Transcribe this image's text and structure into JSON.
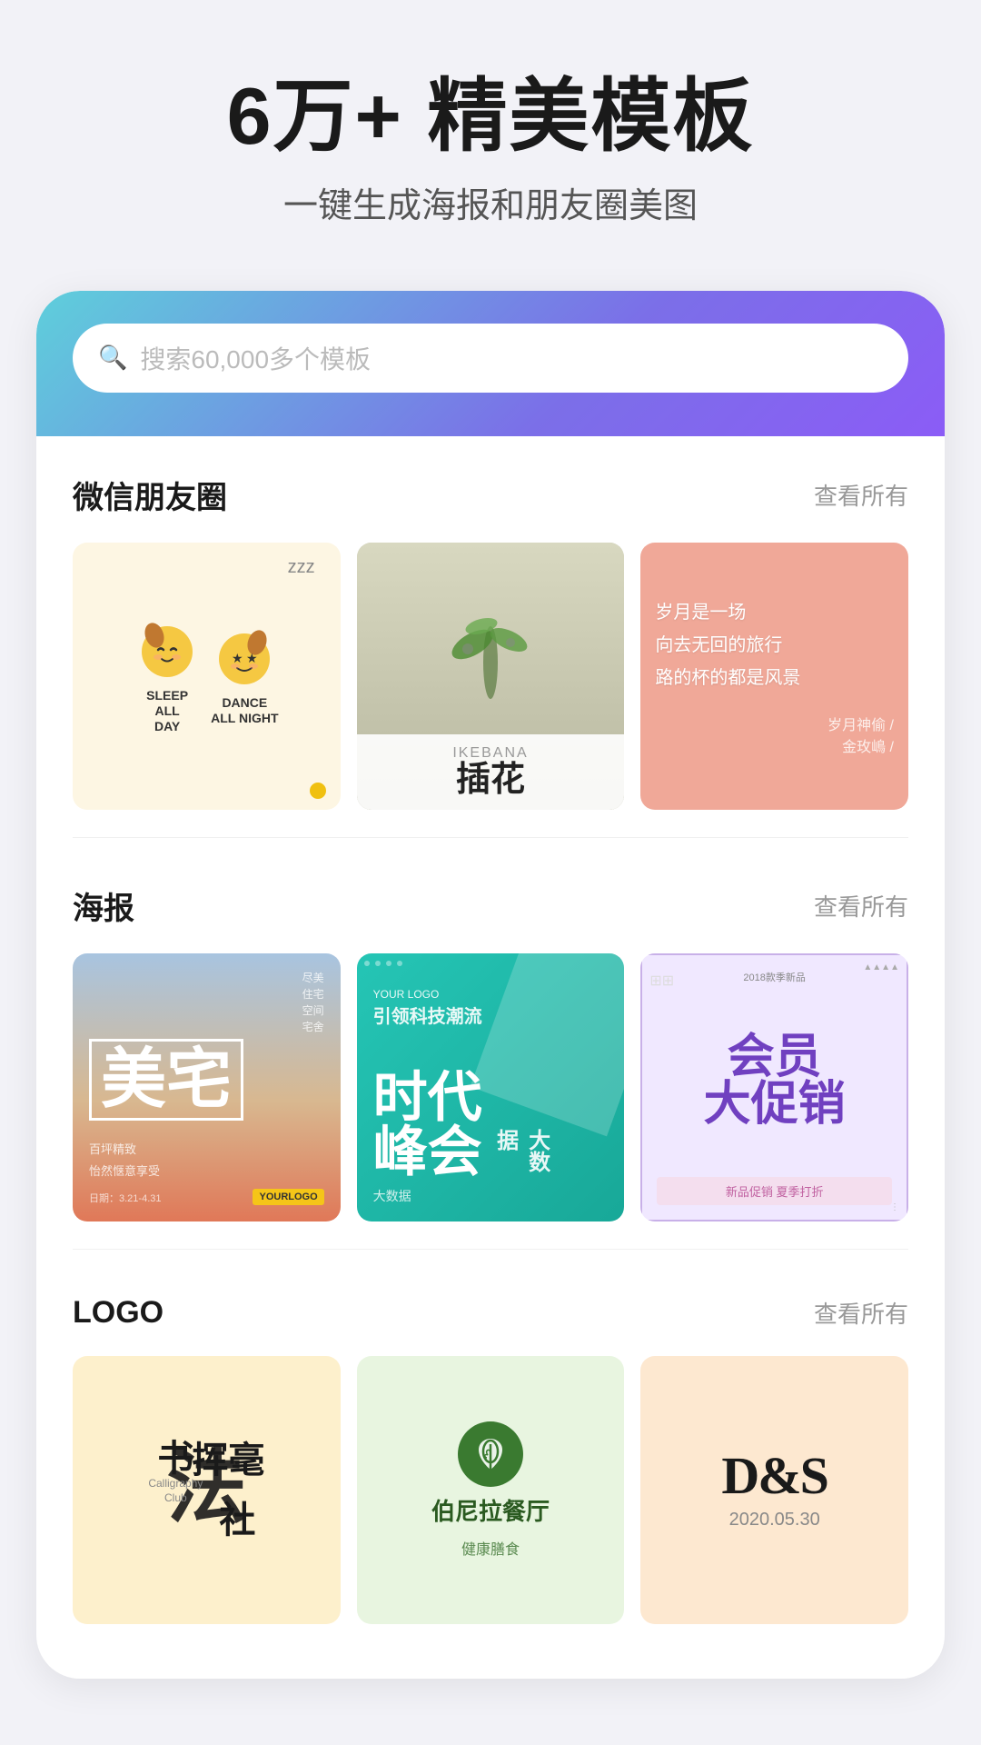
{
  "hero": {
    "title": "6万+ 精美模板",
    "subtitle": "一键生成海报和朋友圈美图"
  },
  "search": {
    "placeholder": "搜索60,000多个模板"
  },
  "sections": {
    "wechat": {
      "title": "微信朋友圈",
      "more": "查看所有"
    },
    "poster": {
      "title": "海报",
      "more": "查看所有"
    },
    "logo": {
      "title": "LOGO",
      "more": "查看所有"
    }
  },
  "wechat_templates": [
    {
      "type": "sleep_dance",
      "char1": "SLEEP\nALL\nDAY",
      "char2": "DANCE\nALL NIGHT",
      "bg": "#fdf6e3"
    },
    {
      "type": "ikebana",
      "en": "IKEBANA",
      "zh": "插花",
      "bg": "#e8e8e0"
    },
    {
      "type": "poem",
      "lines": [
        "岁月是一场",
        "向去无回的旅行",
        "路的杯的都是风景"
      ],
      "footer": "岁月神偷 / 金玫嶋 /",
      "bg": "#f4a0a0"
    }
  ],
  "poster_templates": [
    {
      "title": "美宅",
      "sub1": "尽美住宅空间宅舍",
      "sub2": "百坪精致 怡然惬意享受",
      "logo": "YOUR LOGO",
      "date": "日期：3.21-4.31",
      "bg1": "#aac8e4",
      "bg2": "#e88060"
    },
    {
      "yourlogo": "YOUR LOGO",
      "title1": "时代",
      "title2": "峰会",
      "title3": "大数据",
      "tag": "引领科技潮流",
      "sub": "大数据",
      "bg": "#3dd8c8"
    },
    {
      "title": "会员\n大促销",
      "year": "2018款季新品",
      "desc": "新品促销 夏季打折",
      "bg": "#f0e8ff"
    }
  ],
  "logo_templates": [
    {
      "zh_big": "书法",
      "en_small": "Calligraphy\nClub",
      "zh_small": "挥毫",
      "zh_bottom": "社",
      "bg": "#fdf0cc"
    },
    {
      "name": "伯尼拉餐厅",
      "sub": "健康膳食",
      "bg": "#e8f5e0"
    },
    {
      "text": "D&S",
      "date": "2020.05.30",
      "bg": "#fde8d0"
    }
  ]
}
